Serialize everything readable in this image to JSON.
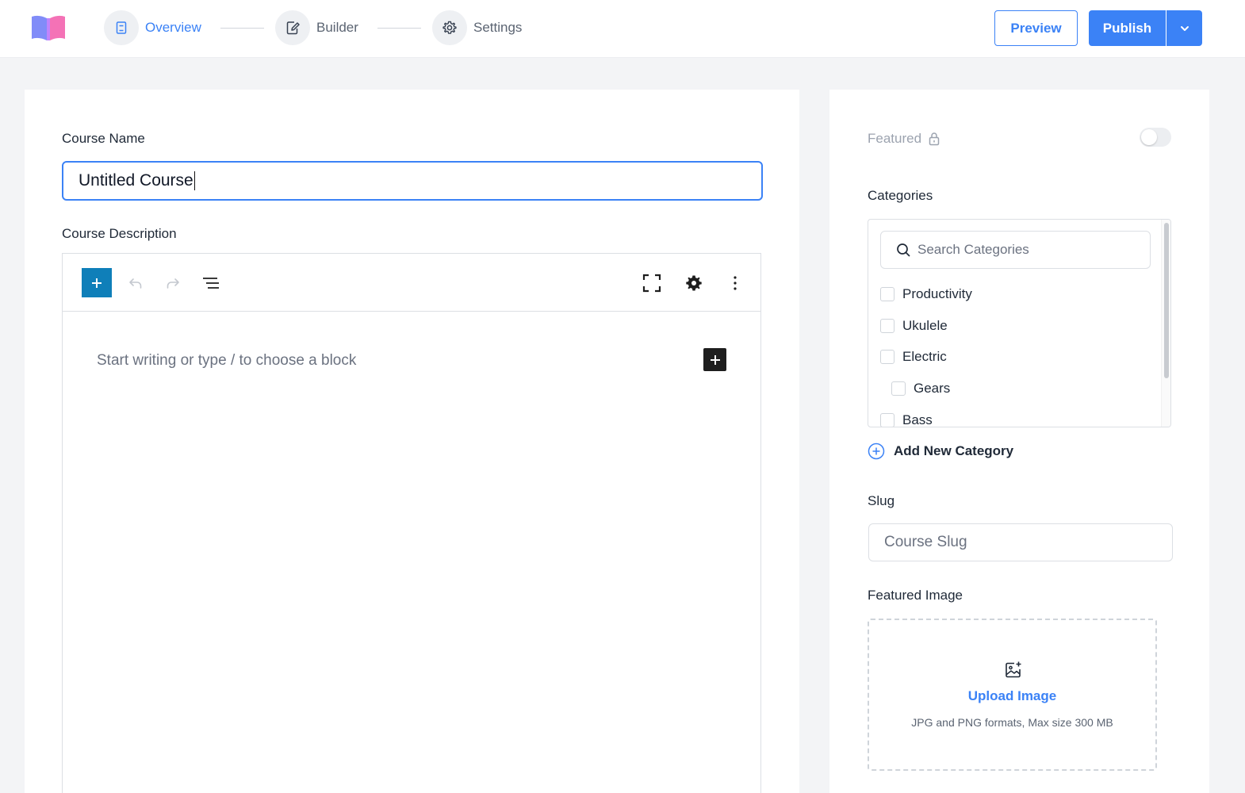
{
  "app": {
    "logo": "book-logo"
  },
  "steps": [
    {
      "label": "Overview",
      "icon": "book-icon",
      "active": true
    },
    {
      "label": "Builder",
      "icon": "edit-icon",
      "active": false
    },
    {
      "label": "Settings",
      "icon": "gear-icon",
      "active": false
    }
  ],
  "header": {
    "preview_label": "Preview",
    "publish_label": "Publish",
    "publish_dropdown_icon": "chevron-down-icon"
  },
  "course": {
    "name_label": "Course Name",
    "name_value": "Untitled Course",
    "description_label": "Course Description",
    "editor_placeholder": "Start writing or type / to choose a block"
  },
  "sidebar": {
    "featured_label": "Featured",
    "featured_enabled": false,
    "categories_label": "Categories",
    "search_placeholder": "Search Categories",
    "categories": [
      {
        "label": "Productivity",
        "checked": false,
        "child": false
      },
      {
        "label": "Ukulele",
        "checked": false,
        "child": false
      },
      {
        "label": "Electric",
        "checked": false,
        "child": false
      },
      {
        "label": "Gears",
        "checked": false,
        "child": true
      },
      {
        "label": "Bass",
        "checked": false,
        "child": false
      }
    ],
    "add_category_label": "Add New Category",
    "slug_label": "Slug",
    "slug_placeholder": "Course Slug",
    "featured_image_label": "Featured Image",
    "upload_label": "Upload Image",
    "upload_hint": "JPG and PNG formats, Max size 300 MB"
  },
  "colors": {
    "accent": "#3b82f6",
    "editor_add": "#0f7fb9",
    "background": "#f3f4f6"
  }
}
